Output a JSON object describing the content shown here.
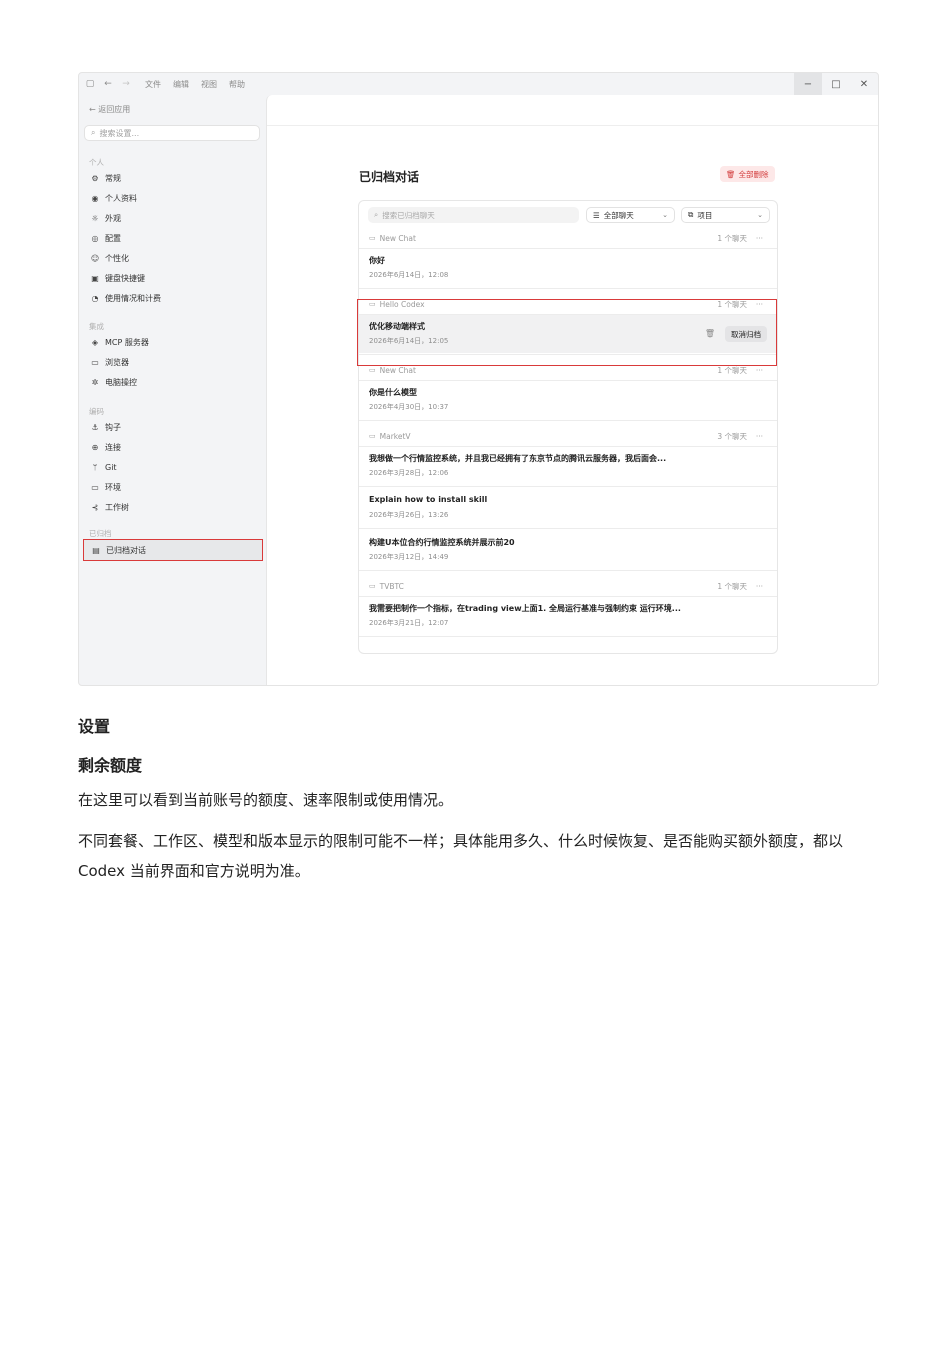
{
  "window": {
    "menu": [
      "文件",
      "编辑",
      "视图",
      "帮助"
    ],
    "controls": [
      "−",
      "□",
      "✕"
    ]
  },
  "sidebar": {
    "back": "返回应用",
    "search_placeholder": "搜索设置...",
    "sections": [
      {
        "label": "个人",
        "items": [
          {
            "icon": "gear-icon",
            "glyph": "⚙",
            "label": "常规"
          },
          {
            "icon": "user-icon",
            "glyph": "◉",
            "label": "个人资料"
          },
          {
            "icon": "sun-icon",
            "glyph": "☼",
            "label": "外观"
          },
          {
            "icon": "config-icon",
            "glyph": "◎",
            "label": "配置"
          },
          {
            "icon": "personalize-icon",
            "glyph": "☺",
            "label": "个性化"
          },
          {
            "icon": "keyboard-icon",
            "glyph": "▣",
            "label": "键盘快捷键"
          },
          {
            "icon": "usage-icon",
            "glyph": "◔",
            "label": "使用情况和计费"
          }
        ]
      },
      {
        "label": "集成",
        "items": [
          {
            "icon": "mcp-icon",
            "glyph": "◈",
            "label": "MCP 服务器"
          },
          {
            "icon": "browser-icon",
            "glyph": "▭",
            "label": "浏览器"
          },
          {
            "icon": "computer-control-icon",
            "glyph": "✲",
            "label": "电脑操控"
          }
        ]
      },
      {
        "label": "编码",
        "items": [
          {
            "icon": "hook-icon",
            "glyph": "⚓",
            "label": "钩子"
          },
          {
            "icon": "globe-icon",
            "glyph": "⊕",
            "label": "连接"
          },
          {
            "icon": "git-icon",
            "glyph": "ᛘ",
            "label": "Git"
          },
          {
            "icon": "environment-icon",
            "glyph": "▭",
            "label": "环境"
          },
          {
            "icon": "worktree-icon",
            "glyph": "⊰",
            "label": "工作树"
          }
        ]
      },
      {
        "label": "已归档",
        "items": [
          {
            "icon": "archive-icon",
            "glyph": "▤",
            "label": "已归档对话",
            "active": true
          }
        ]
      }
    ]
  },
  "main": {
    "title": "已归档对话",
    "delete_all": "全部删除",
    "search_placeholder": "搜索已归档聊天",
    "filter_chats": "全部聊天",
    "filter_project": "项目",
    "groups": [
      {
        "name": "New Chat",
        "count": "1 个聊天",
        "chats": [
          {
            "title": "你好",
            "date": "2026年6月14日，12:08"
          }
        ]
      },
      {
        "name": "Hello Codex",
        "count": "1 个聊天",
        "chats": [
          {
            "title": "优化移动端样式",
            "date": "2026年6月14日，12:05",
            "action": "取消归档"
          }
        ]
      },
      {
        "name": "New Chat",
        "count": "1 个聊天",
        "chats": [
          {
            "title": "你是什么模型",
            "date": "2026年4月30日，10:37"
          }
        ]
      },
      {
        "name": "MarketV",
        "count": "3 个聊天",
        "chats": [
          {
            "title": "我想做一个行情监控系统，并且我已经拥有了东京节点的腾讯云服务器，我后面会...",
            "date": "2026年3月28日，12:06"
          },
          {
            "title": "Explain how to install skill",
            "date": "2026年3月26日，13:26"
          },
          {
            "title": "构建U本位合约行情监控系统并展示前20",
            "date": "2026年3月12日，14:49"
          }
        ]
      },
      {
        "name": "TVBTC",
        "count": "1 个聊天",
        "chats": [
          {
            "title": "我需要把制作一个指标，在trading view上面1. 全局运行基准与强制约束 运行环境...",
            "date": "2026年3月21日，12:07"
          }
        ]
      }
    ]
  },
  "doc": {
    "heading1": "设置",
    "heading2": "剩余额度",
    "para1": "在这里可以看到当前账号的额度、速率限制或使用情况。",
    "para2": "不同套餐、工作区、模型和版本显示的限制可能不一样；具体能用多久、什么时候恢复、是否能购买额外额度，都以 Codex 当前界面和官方说明为准。"
  }
}
